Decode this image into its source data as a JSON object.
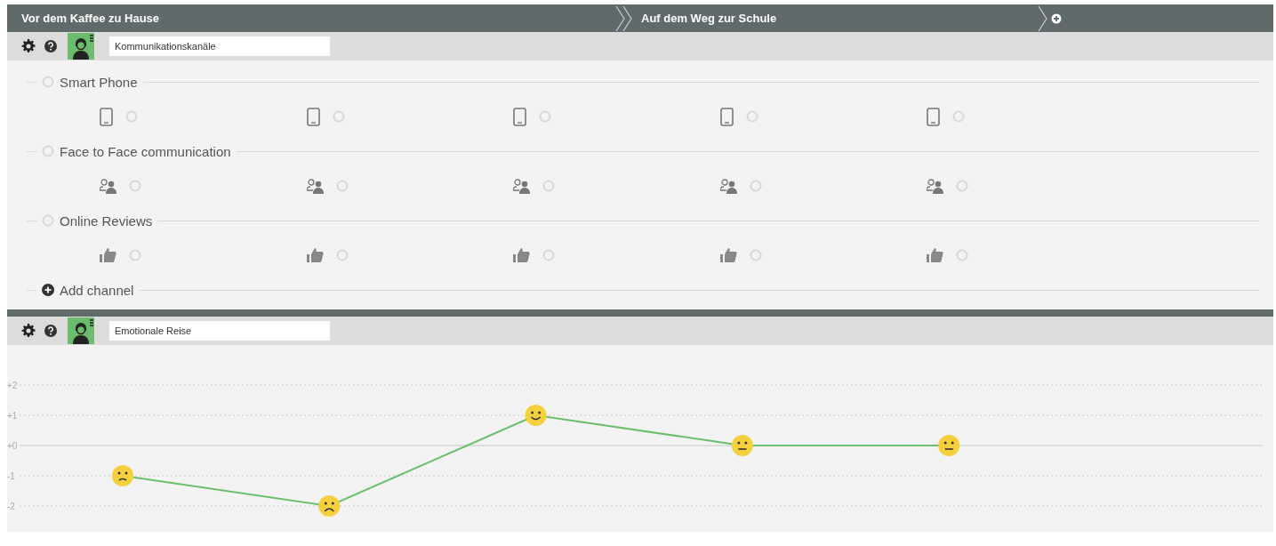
{
  "stages": [
    {
      "label": "Vor dem Kaffee zu Hause"
    },
    {
      "label": "Auf dem Weg zur Schule"
    }
  ],
  "channels_lane": {
    "title": "Kommunikationskanäle",
    "channels": [
      {
        "name": "Smart Phone",
        "kind": "phone"
      },
      {
        "name": "Face to Face communication",
        "kind": "people"
      },
      {
        "name": "Online Reviews",
        "kind": "thumb"
      }
    ],
    "add_label": "Add channel"
  },
  "emotion_lane": {
    "title": "Emotionale Reise",
    "chart_data": {
      "type": "line",
      "ylim": [
        -2,
        2
      ],
      "yticks": [
        {
          "value": 2,
          "label": "+2"
        },
        {
          "value": 1,
          "label": "+1"
        },
        {
          "value": 0,
          "label": "+0"
        },
        {
          "value": -1,
          "label": "-1"
        },
        {
          "value": -2,
          "label": "-2"
        }
      ],
      "series": [
        {
          "color": "#6cbf6c",
          "marker": "circle",
          "values": [
            -1,
            -2,
            1,
            0,
            0
          ]
        }
      ]
    }
  }
}
